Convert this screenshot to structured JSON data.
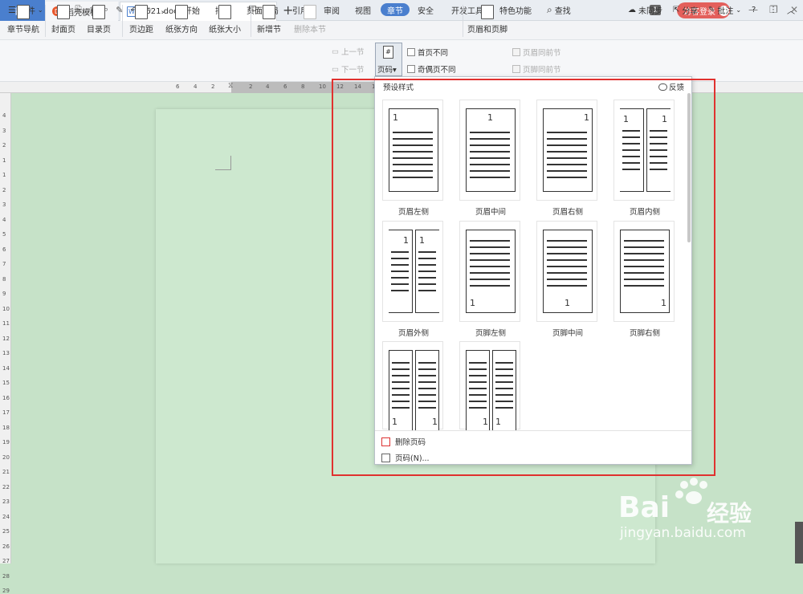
{
  "titlebar": {
    "tabs": [
      {
        "label": "首页"
      },
      {
        "label": "稻壳模板"
      },
      {
        "label": "7621.doc"
      }
    ],
    "new_tab": "+",
    "page_count": "1",
    "login": "访客登录",
    "doc_icon": "W",
    "template_icon": "D",
    "window_controls": [
      "—",
      "❐",
      "✕"
    ],
    "tab_dot_color": "#e8562a",
    "accent_color": "#4a7fce"
  },
  "menubar": {
    "file": "文件",
    "items": [
      "开始",
      "插入",
      "页面布局",
      "引用",
      "审阅",
      "视图",
      "章节",
      "安全",
      "开发工具",
      "特色功能"
    ],
    "search": "查找",
    "sync": "未同步",
    "share": "分享",
    "comment": "批注",
    "help": "?",
    "more": "⋮",
    "collapse": "︿"
  },
  "ribbon": {
    "buttons": [
      "章节导航",
      "封面页",
      "目录页",
      "页边距",
      "纸张方向",
      "纸张大小",
      "新增节",
      "删除本节"
    ],
    "prev_section": "上一节",
    "next_section": "下一节",
    "page_code": "页码",
    "first_page_diff": "首页不同",
    "odd_even_diff": "奇偶页不同",
    "header_footer": "页眉和页脚",
    "header_same_prev": "页眉同前节",
    "footer_same_prev": "页脚同前节"
  },
  "ruler": {
    "h_numbers": [
      "6",
      "4",
      "2",
      "2",
      "4",
      "6",
      "8",
      "10",
      "12",
      "14",
      "16",
      "18",
      "20",
      "22",
      "24",
      "26"
    ],
    "v_numbers": [
      "4",
      "3",
      "2",
      "1",
      "1",
      "2",
      "3",
      "4",
      "5",
      "6",
      "7",
      "8",
      "9",
      "10",
      "11",
      "12",
      "13",
      "14",
      "15",
      "16",
      "17",
      "18",
      "19",
      "20",
      "21",
      "22",
      "23",
      "24",
      "25",
      "26",
      "27",
      "28",
      "29"
    ]
  },
  "dropdown": {
    "title": "预设样式",
    "feedback": "反馈",
    "styles": [
      {
        "label": "页眉左侧",
        "number": "1"
      },
      {
        "label": "页眉中间",
        "number": "1"
      },
      {
        "label": "页眉右侧",
        "number": "1"
      },
      {
        "label": "页眉内侧",
        "number": "1"
      },
      {
        "label": "页眉外侧",
        "number": "1"
      },
      {
        "label": "页脚左侧",
        "number": "1"
      },
      {
        "label": "页脚中间",
        "number": "1"
      },
      {
        "label": "页脚右侧",
        "number": "1"
      },
      {
        "label": "",
        "number": "1"
      },
      {
        "label": "",
        "number": "1"
      }
    ],
    "delete_page_numbers": "删除页码",
    "page_numbers_dialog": "页码(N)..."
  },
  "watermark": {
    "brand_left": "Bai",
    "brand_right": "经验",
    "url": "jingyan.baidu.com"
  }
}
